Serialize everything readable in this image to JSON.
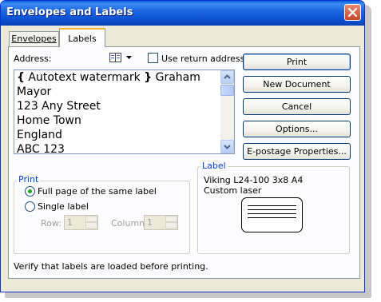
{
  "window": {
    "title": "Envelopes and Labels"
  },
  "tabs": [
    {
      "label": "Envelopes",
      "selected": false
    },
    {
      "label": "Labels",
      "selected": true
    }
  ],
  "address": {
    "label": "Address:",
    "lines": [
      "Autotext watermark",
      "Mayor",
      "123 Any Street",
      "Home Town",
      "England",
      "ABC 123"
    ],
    "first_line_field": "Autotext watermark",
    "first_line_rest": "Graham"
  },
  "use_return_address": {
    "label": "Use return address",
    "checked": false
  },
  "buttons": {
    "print": "Print",
    "new_document": "New Document",
    "cancel": "Cancel",
    "options": "Options...",
    "epostage": "E-postage Properties..."
  },
  "print_group": {
    "title": "Print",
    "full_page": "Full page of the same label",
    "single_label": "Single label",
    "selected": "full_page",
    "row_label": "Row:",
    "row_value": "1",
    "column_label": "Column:",
    "column_value": "1"
  },
  "label_group": {
    "title": "Label",
    "name": "Viking L24-100 3x8 A4",
    "type": "Custom laser"
  },
  "footer_note": "Verify that labels are loaded before printing.",
  "icons": [
    "close-icon",
    "address-book-icon",
    "dropdown-arrow-icon",
    "scroll-up-icon",
    "scroll-down-icon"
  ],
  "colors": {
    "titlebar": "#0a5fd8",
    "dialog_bg": "#ece9d8",
    "group_title": "#0046d5",
    "close_button": "#c8462a"
  }
}
